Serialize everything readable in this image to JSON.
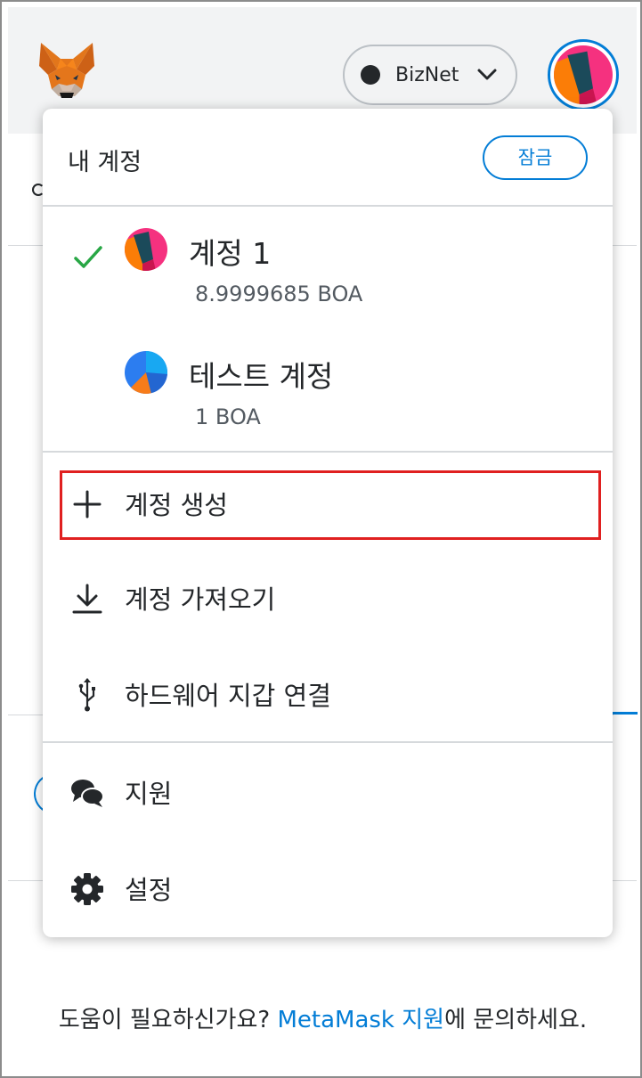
{
  "header": {
    "network_label": "BizNet"
  },
  "menu": {
    "title": "내 계정",
    "lock_label": "잠금",
    "accounts": [
      {
        "name": "계정 1",
        "balance": "8.9999685 BOA",
        "selected": true
      },
      {
        "name": "테스트 계정",
        "balance": "1 BOA",
        "selected": false
      }
    ],
    "items": [
      {
        "label": "계정 생성",
        "icon": "plus-icon"
      },
      {
        "label": "계정 가져오기",
        "icon": "download-icon"
      },
      {
        "label": "하드웨어 지갑 연결",
        "icon": "usb-icon"
      },
      {
        "label": "지원",
        "icon": "chat-icon"
      },
      {
        "label": "설정",
        "icon": "gear-icon"
      }
    ]
  },
  "help": {
    "prefix": "도움이 필요하신가요? ",
    "link": "MetaMask 지원",
    "suffix": "에 문의하세요."
  },
  "colors": {
    "accent": "#037dd6",
    "check": "#28a745",
    "highlight": "#e02020",
    "text": "#24272a"
  }
}
